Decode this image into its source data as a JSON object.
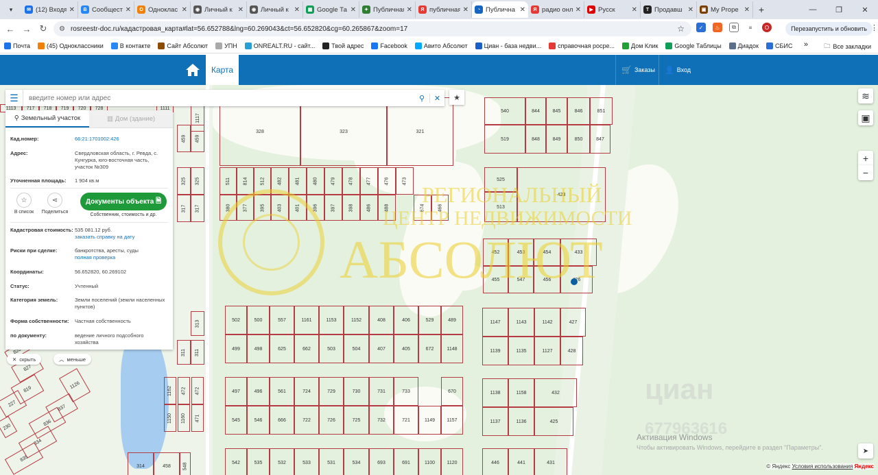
{
  "tabs": [
    {
      "title": "(12) Входя",
      "color": "#1a73e8",
      "icon": "✉",
      "active": false
    },
    {
      "title": "Сообщест",
      "color": "#2787f5",
      "icon": "В",
      "active": false
    },
    {
      "title": "Одноклас",
      "color": "#ee8208",
      "icon": "О",
      "active": false
    },
    {
      "title": "Личный к",
      "color": "#555555",
      "icon": "◉",
      "active": false
    },
    {
      "title": "Личный к",
      "color": "#555555",
      "icon": "◉",
      "active": false
    },
    {
      "title": "Google Та",
      "color": "#0f9d58",
      "icon": "▦",
      "active": false
    },
    {
      "title": "Публичная",
      "color": "#2e7d32",
      "icon": "✦",
      "active": false
    },
    {
      "title": "публичная",
      "color": "#e53935",
      "icon": "Я",
      "active": false
    },
    {
      "title": "Публична",
      "color": "#1565c0",
      "icon": "◔",
      "active": true
    },
    {
      "title": "радио онл",
      "color": "#e53935",
      "icon": "Я",
      "active": false
    },
    {
      "title": "Русск",
      "color": "#e00000",
      "icon": "▶",
      "active": false
    },
    {
      "title": "Продавш",
      "color": "#222222",
      "icon": "T",
      "active": false
    },
    {
      "title": "My Prope",
      "color": "#7b3f00",
      "icon": "▣",
      "active": false
    }
  ],
  "url": "rosreestr-doc.ru/кадастровая_карта#lat=56.652788&lng=60.269043&ct=56.652820&cg=60.265867&zoom=17",
  "relaunch_label": "Перезапустить и обновить",
  "profile_letter": "О",
  "bookmarks": [
    {
      "label": "Почта",
      "color": "#1a73e8"
    },
    {
      "label": "(45) Одноклассники",
      "color": "#ee8208"
    },
    {
      "label": "В контакте",
      "color": "#2787f5"
    },
    {
      "label": "Сайт Абсолют",
      "color": "#8d4b00"
    },
    {
      "label": "УПН",
      "color": "#aaaaaa"
    },
    {
      "label": "ONREALT.RU - сайт...",
      "color": "#2a9fd6"
    },
    {
      "label": "Твой адрес",
      "color": "#222222"
    },
    {
      "label": "Facebook",
      "color": "#1877f2"
    },
    {
      "label": "Авито Абсолют",
      "color": "#00aaff"
    },
    {
      "label": "Циан - база недви...",
      "color": "#1a5fc8"
    },
    {
      "label": "справочная росре...",
      "color": "#e53935"
    },
    {
      "label": "Дом Клик",
      "color": "#21a038"
    },
    {
      "label": "Google Таблицы",
      "color": "#0f9d58"
    },
    {
      "label": "Диадок",
      "color": "#5b6f8a"
    },
    {
      "label": "СБИС",
      "color": "#2a6fd6"
    }
  ],
  "bookmarks_more": "»",
  "all_bookmarks": "Все закладки",
  "header": {
    "map_label": "Карта",
    "orders_label": "Заказы",
    "login_label": "Вход",
    "color": "#0f70b7"
  },
  "search": {
    "placeholder": "введите номер или адрес"
  },
  "panel": {
    "tab_land": "Земельный участок",
    "tab_house": "Дом (здание)",
    "rows": [
      {
        "label": "Кад.номер:",
        "value": "66:21:1701002:426",
        "link": ""
      },
      {
        "label": "Адрес:",
        "value": "Свердловская область, г. Ревда, с. Кунгурка, юго-восточная часть, участок №309",
        "link": ""
      },
      {
        "label": "Уточненная площадь:",
        "value": "1 904 кв.м",
        "link": ""
      },
      {
        "label": "Кадастровая стоимость:",
        "value": "535 081.12 руб.",
        "link": "заказать справку на дату"
      },
      {
        "label": "Риски при сделке:",
        "value": "банкротства, аресты, суды",
        "link": "полная проверка"
      },
      {
        "label": "Координаты:",
        "value": "56.652820, 60.269102",
        "link": ""
      },
      {
        "label": "Статус:",
        "value": "Учтенный",
        "link": ""
      },
      {
        "label": "Категория земель:",
        "value": "Земли поселений (земли населенных пунктов)",
        "link": ""
      },
      {
        "label": "Форма собственности:",
        "value": "Частная собственность",
        "link": ""
      },
      {
        "label": "по документу:",
        "value": "ведение личного подсобного хозяйства",
        "link": ""
      }
    ],
    "add_list": "В список",
    "share": "Поделиться",
    "docs_button": "Документы объекта",
    "docs_sub": "Собственник, стоимость и др."
  },
  "pill_hide": "скрыть",
  "pill_less": "меньше",
  "map": {
    "plots": [
      {
        "n": "540"
      },
      {
        "n": "844"
      },
      {
        "n": "845"
      },
      {
        "n": "846"
      },
      {
        "n": "851"
      },
      {
        "n": "519"
      },
      {
        "n": "848"
      },
      {
        "n": "849"
      },
      {
        "n": "850"
      },
      {
        "n": "847"
      },
      {
        "n": "525"
      },
      {
        "n": "423"
      },
      {
        "n": "513"
      },
      {
        "n": "452"
      },
      {
        "n": "453"
      },
      {
        "n": "454"
      },
      {
        "n": "433"
      },
      {
        "n": "455"
      },
      {
        "n": "547"
      },
      {
        "n": "456"
      },
      {
        "n": "426"
      },
      {
        "n": "328"
      },
      {
        "n": "323"
      },
      {
        "n": "321"
      },
      {
        "n": "511"
      },
      {
        "n": "814"
      },
      {
        "n": "512"
      },
      {
        "n": "482"
      },
      {
        "n": "481"
      },
      {
        "n": "480"
      },
      {
        "n": "479"
      },
      {
        "n": "478"
      },
      {
        "n": "477"
      },
      {
        "n": "476"
      },
      {
        "n": "473"
      },
      {
        "n": "380"
      },
      {
        "n": "377"
      },
      {
        "n": "395"
      },
      {
        "n": "403"
      },
      {
        "n": "401"
      },
      {
        "n": "396"
      },
      {
        "n": "397"
      },
      {
        "n": "398"
      },
      {
        "n": "486"
      },
      {
        "n": "488"
      },
      {
        "n": "674"
      },
      {
        "n": "466"
      },
      {
        "n": "502"
      },
      {
        "n": "500"
      },
      {
        "n": "557"
      },
      {
        "n": "1161"
      },
      {
        "n": "1153"
      },
      {
        "n": "1152"
      },
      {
        "n": "408"
      },
      {
        "n": "406"
      },
      {
        "n": "529"
      },
      {
        "n": "489"
      },
      {
        "n": "499"
      },
      {
        "n": "498"
      },
      {
        "n": "625"
      },
      {
        "n": "662"
      },
      {
        "n": "503"
      },
      {
        "n": "504"
      },
      {
        "n": "407"
      },
      {
        "n": "405"
      },
      {
        "n": "672"
      },
      {
        "n": "1148"
      },
      {
        "n": "1147"
      },
      {
        "n": "1143"
      },
      {
        "n": "1142"
      },
      {
        "n": "427"
      },
      {
        "n": "1139"
      },
      {
        "n": "1135"
      },
      {
        "n": "1127"
      },
      {
        "n": "428"
      },
      {
        "n": "497"
      },
      {
        "n": "496"
      },
      {
        "n": "561"
      },
      {
        "n": "724"
      },
      {
        "n": "729"
      },
      {
        "n": "730"
      },
      {
        "n": "731"
      },
      {
        "n": "733"
      },
      {
        "n": "670"
      },
      {
        "n": "545"
      },
      {
        "n": "546"
      },
      {
        "n": "666"
      },
      {
        "n": "722"
      },
      {
        "n": "726"
      },
      {
        "n": "725"
      },
      {
        "n": "732"
      },
      {
        "n": "721"
      },
      {
        "n": "1149"
      },
      {
        "n": "1157"
      },
      {
        "n": "1138"
      },
      {
        "n": "1158"
      },
      {
        "n": "432"
      },
      {
        "n": "1137"
      },
      {
        "n": "1136"
      },
      {
        "n": "425"
      },
      {
        "n": "542"
      },
      {
        "n": "535"
      },
      {
        "n": "532"
      },
      {
        "n": "533"
      },
      {
        "n": "531"
      },
      {
        "n": "534"
      },
      {
        "n": "693"
      },
      {
        "n": "691"
      },
      {
        "n": "1100"
      },
      {
        "n": "1120"
      },
      {
        "n": "446"
      },
      {
        "n": "441"
      },
      {
        "n": "431"
      },
      {
        "n": "314"
      },
      {
        "n": "458"
      },
      {
        "n": "548"
      },
      {
        "n": "1162"
      },
      {
        "n": "472"
      },
      {
        "n": "472"
      },
      {
        "n": "1150"
      },
      {
        "n": "1160"
      },
      {
        "n": "471"
      },
      {
        "n": "459"
      },
      {
        "n": "459"
      },
      {
        "n": "325"
      },
      {
        "n": "325"
      },
      {
        "n": "317"
      },
      {
        "n": "317"
      },
      {
        "n": "313"
      },
      {
        "n": "311"
      },
      {
        "n": "311"
      },
      {
        "n": "1113"
      },
      {
        "n": "717"
      },
      {
        "n": "718"
      },
      {
        "n": "719"
      },
      {
        "n": "720"
      },
      {
        "n": "728"
      },
      {
        "n": "1111"
      },
      {
        "n": "1117"
      },
      {
        "n": "827"
      },
      {
        "n": "1126"
      },
      {
        "n": "819"
      },
      {
        "n": "227"
      },
      {
        "n": "837"
      },
      {
        "n": "836"
      },
      {
        "n": "834"
      },
      {
        "n": "835"
      },
      {
        "n": "230"
      },
      {
        "n": "828"
      }
    ],
    "watermark_1": "РЕГИОНАЛЬНЫЙ",
    "watermark_2": "ЦЕНТР НЕДВИЖИМОСТИ",
    "watermark_3": "АБСОЛЮТ",
    "seal_text": "ЦЕНТР НЕДВИЖИМОСТИ АБСОЛЮТ",
    "cian_1": "циан",
    "cian_2": "677963616",
    "activate_1": "Активация Windows",
    "activate_2": "Чтобы активировать Windows, перейдите в раздел \"Параметры\".",
    "copyright": "© Яндекс",
    "terms": "Условия использования",
    "yandex": "Яндекс"
  }
}
